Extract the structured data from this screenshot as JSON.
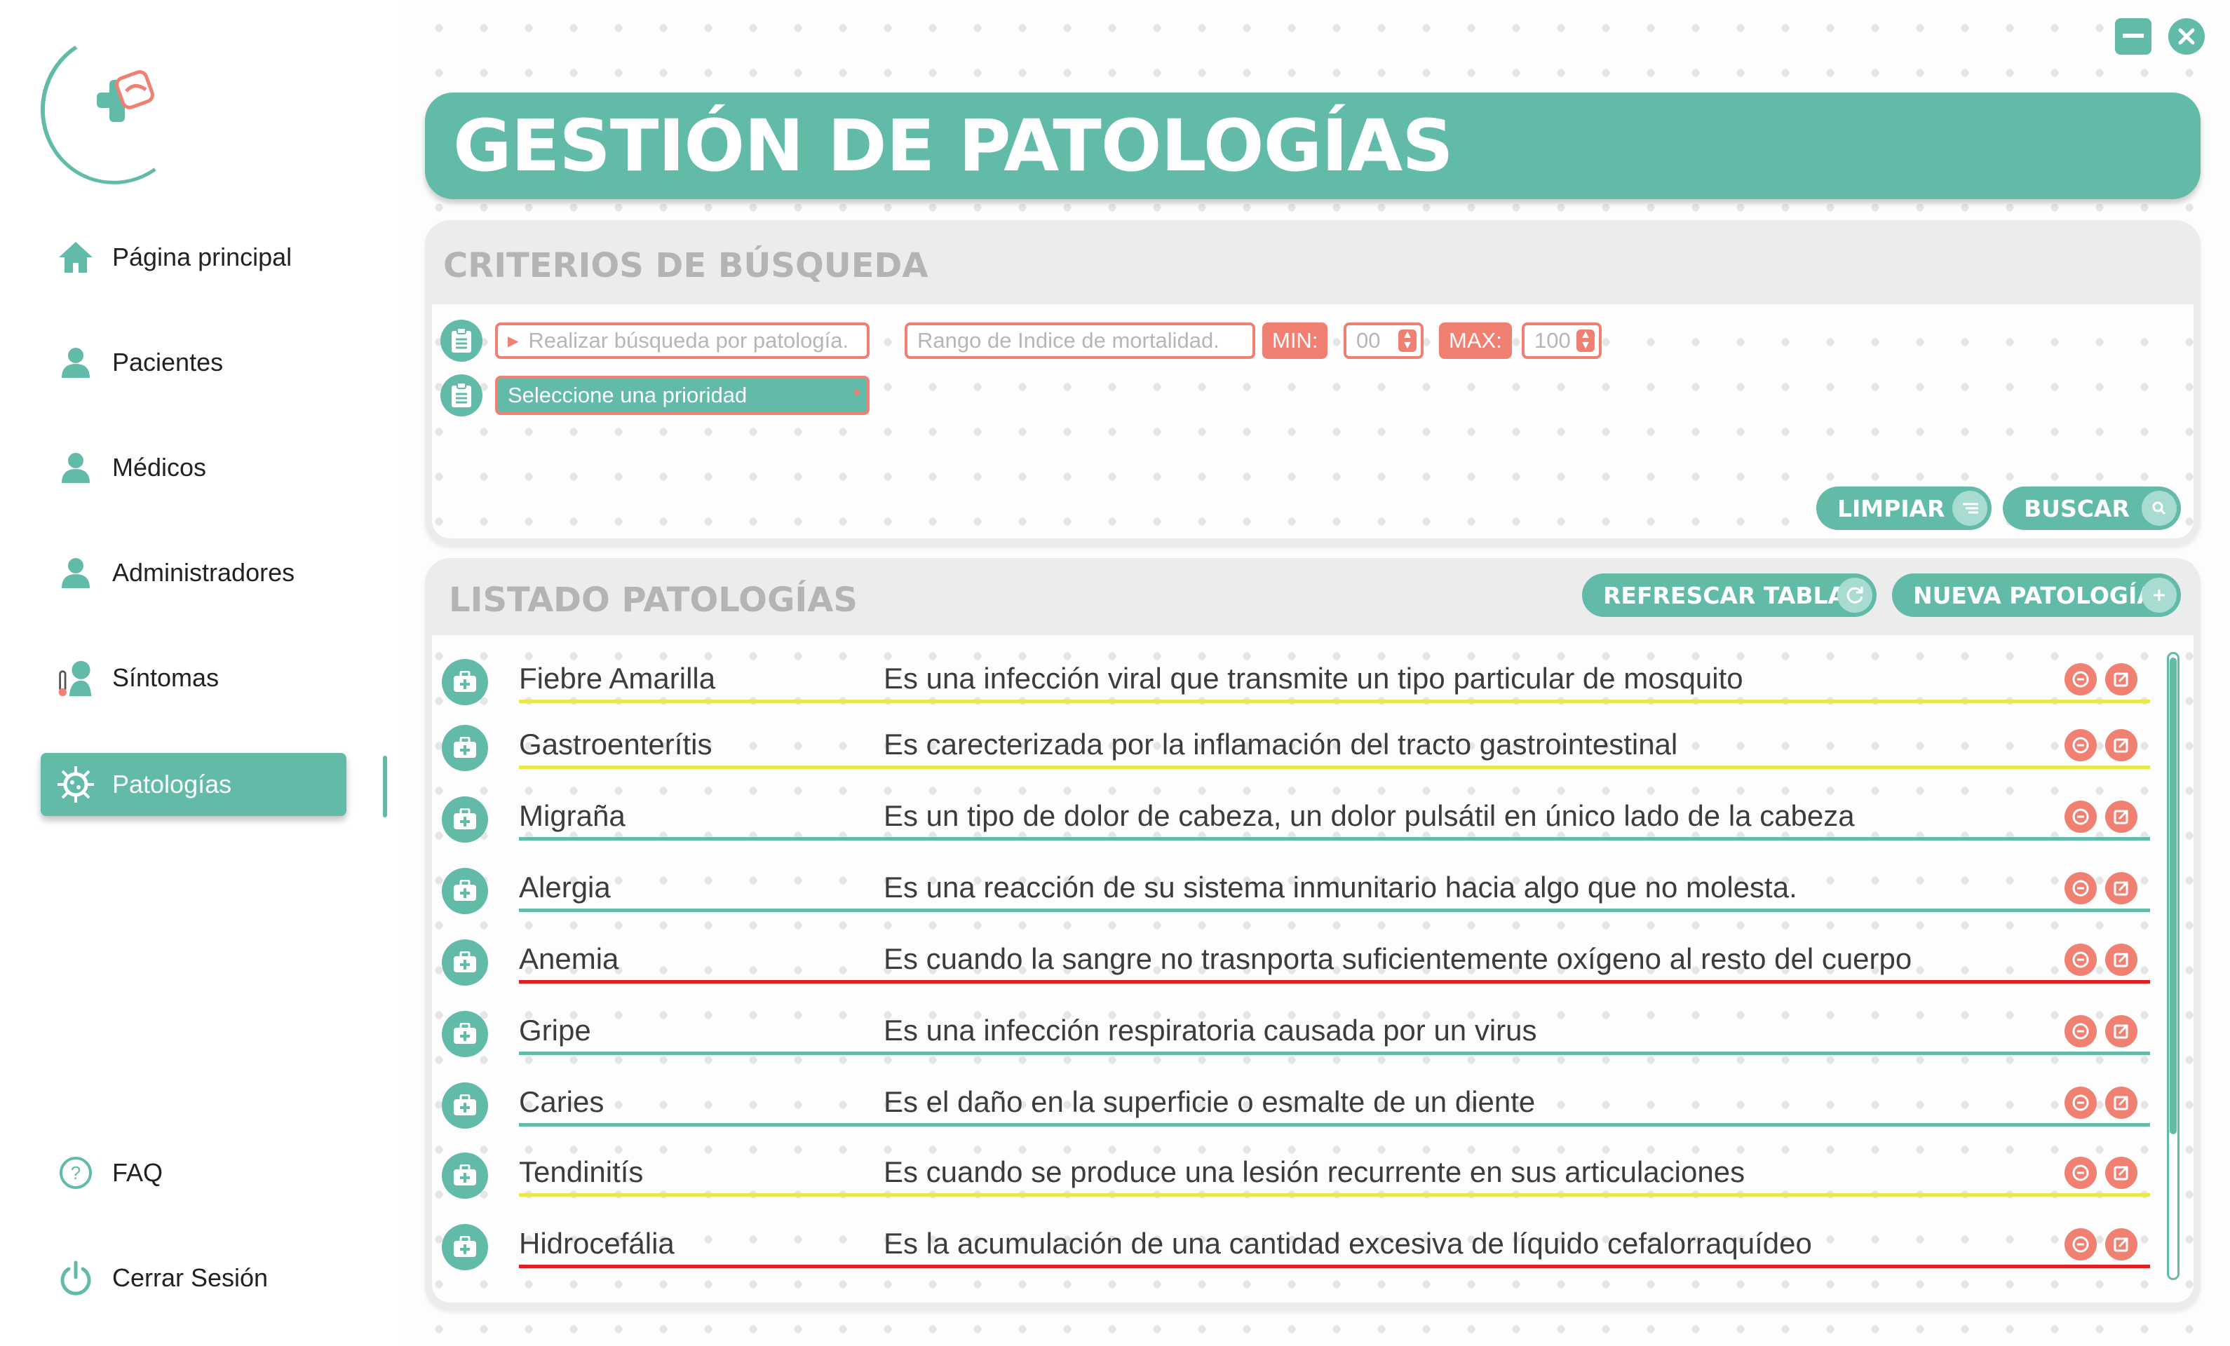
{
  "nav": {
    "items": [
      {
        "label": "Página principal",
        "icon": "home-icon"
      },
      {
        "label": "Pacientes",
        "icon": "user-icon"
      },
      {
        "label": "Médicos",
        "icon": "user-icon"
      },
      {
        "label": "Administradores",
        "icon": "user-icon"
      },
      {
        "label": "Síntomas",
        "icon": "symptoms-icon"
      },
      {
        "label": "Patologías",
        "icon": "virus-icon",
        "active": true
      }
    ],
    "faq": "FAQ",
    "logout": "Cerrar Sesión"
  },
  "header": {
    "title": "GESTIÓN DE PATOLOGÍAS"
  },
  "search": {
    "title": "CRITERIOS DE BÚSQUEDA",
    "pathology_placeholder": "Realizar búsqueda por patología.",
    "mortality_placeholder": "Rango de Indice de mortalidad.",
    "min_label": "MIN:",
    "min_value": "00",
    "max_label": "MAX:",
    "max_value": "100",
    "priority_placeholder": "Seleccione una prioridad",
    "clear_label": "LIMPIAR",
    "search_label": "BUSCAR"
  },
  "list": {
    "title": "LISTADO PATOLOGÍAS",
    "refresh_label": "REFRESCAR TABLA",
    "new_label": "NUEVA PATOLOGÍA",
    "rows": [
      {
        "name": "Fiebre Amarilla",
        "description": "Es una infección viral que transmite un tipo particular de mosquito",
        "priority_color": "#e8e84a"
      },
      {
        "name": "Gastroenterítis",
        "description": "Es carecterizada por la inflamación del tracto gastrointestinal",
        "priority_color": "#e8e84a"
      },
      {
        "name": "Migraña",
        "description": "Es un tipo de dolor de cabeza, un dolor pulsátil en único lado de la cabeza",
        "priority_color": "#62bba9"
      },
      {
        "name": "Alergia",
        "description": "Es una reacción de su sistema inmunitario hacia algo que no molesta.",
        "priority_color": "#62bba9"
      },
      {
        "name": "Anemia",
        "description": "Es cuando la sangre no trasnporta suficientemente oxígeno al resto del cuerpo",
        "priority_color": "#e02020"
      },
      {
        "name": "Gripe",
        "description": "Es una infección respiratoria causada por un virus",
        "priority_color": "#62bba9"
      },
      {
        "name": "Caries",
        "description": "Es el daño en la superficie o esmalte de un diente",
        "priority_color": "#62bba9"
      },
      {
        "name": "Tendinitís",
        "description": "Es cuando se produce una lesión recurrente en sus articulaciones",
        "priority_color": "#e8e84a"
      },
      {
        "name": "Hidrocefália",
        "description": "Es la acumulación de una cantidad excesiva de líquido cefalorraquídeo",
        "priority_color": "#e02020"
      }
    ]
  },
  "colors": {
    "accent": "#62bba9",
    "coral": "#f08072"
  }
}
